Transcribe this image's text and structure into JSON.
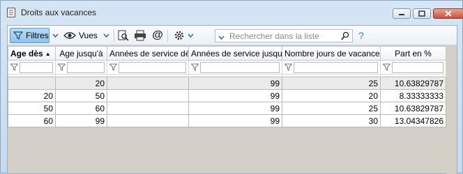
{
  "window": {
    "title": "Droits aux vacances",
    "icon": "list-document-icon"
  },
  "toolbar": {
    "filters_label": "Filtres",
    "views_label": "Vues",
    "search_placeholder": "Rechercher dans la liste",
    "help_label": "?"
  },
  "table": {
    "columns": [
      "Age dès",
      "Age jusqu'à",
      "Années de service dès",
      "Années de service jusqu'à",
      "Nombre jours de vacances",
      "Part en %"
    ],
    "sorted_column": "Age dès",
    "rows": [
      [
        "",
        "20",
        "",
        "99",
        "25",
        "10.63829787"
      ],
      [
        "20",
        "50",
        "",
        "99",
        "20",
        "8.33333333"
      ],
      [
        "50",
        "60",
        "",
        "99",
        "25",
        "10.63829787"
      ],
      [
        "60",
        "99",
        "",
        "99",
        "30",
        "13.04347826"
      ]
    ]
  }
}
